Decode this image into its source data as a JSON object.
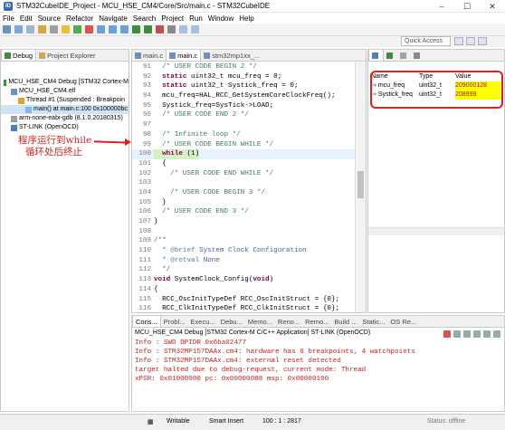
{
  "window": {
    "title": "STM32CubeIDE_Project - MCU_HSE_CM4/Core/Src/main.c - STM32CubeIDE"
  },
  "menu": [
    "File",
    "Edit",
    "Source",
    "Refactor",
    "Navigate",
    "Search",
    "Project",
    "Run",
    "Window",
    "Help"
  ],
  "quick_access": {
    "placeholder": "Quick Access"
  },
  "debug_panel": {
    "tabs": [
      "Debug",
      "Project Explorer"
    ],
    "tree": [
      {
        "label": "MCU_HSE_CM4 Debug [STM32 Cortex-M",
        "indent": 0
      },
      {
        "label": "MCU_HSE_CM4.elf",
        "indent": 1
      },
      {
        "label": "Thread #1 (Suspended : Breakpoin",
        "indent": 2
      },
      {
        "label": "main() at main.c:100 0x100000bc",
        "indent": 3,
        "selected": true
      },
      {
        "label": "arm-none-eabi-gdb (8.1.0.20180315)",
        "indent": 1
      },
      {
        "label": "ST-LINK (OpenOCD)",
        "indent": 1
      }
    ]
  },
  "annotation": {
    "line1": "程序运行到while",
    "line2": "循环处后终止"
  },
  "editor": {
    "tabs": [
      "main.c",
      "main.c",
      "stm32mp1xx_..."
    ],
    "lines": [
      {
        "n": "91",
        "t": "  /* USER CODE BEGIN 2 */"
      },
      {
        "n": "92",
        "t": "  static uint32_t mcu_freq = 0;"
      },
      {
        "n": "93",
        "t": "  static uint32_t Systick_freq = 0;"
      },
      {
        "n": "94",
        "t": "  mcu_freq=HAL_RCC_GetSystemCoreClockFreq();"
      },
      {
        "n": "95",
        "t": "  Systick_freq=SysTick->LOAD;"
      },
      {
        "n": "96",
        "t": "  /* USER CODE END 2 */"
      },
      {
        "n": "97",
        "t": ""
      },
      {
        "n": "98",
        "t": "  /* Infinite loop */"
      },
      {
        "n": "99",
        "t": "  /* USER CODE BEGIN WHILE */"
      },
      {
        "n": "100",
        "t": "  while (1)"
      },
      {
        "n": "101",
        "t": "  {"
      },
      {
        "n": "102",
        "t": "    /* USER CODE END WHILE */"
      },
      {
        "n": "103",
        "t": ""
      },
      {
        "n": "104",
        "t": "    /* USER CODE BEGIN 3 */"
      },
      {
        "n": "105",
        "t": "  }"
      },
      {
        "n": "106",
        "t": "  /* USER CODE END 3 */"
      },
      {
        "n": "107",
        "t": "}"
      },
      {
        "n": "108",
        "t": ""
      },
      {
        "n": "109",
        "t": "/**"
      },
      {
        "n": "110",
        "t": "  * @brief System Clock Configuration"
      },
      {
        "n": "111",
        "t": "  * @retval None"
      },
      {
        "n": "112",
        "t": "  */"
      },
      {
        "n": "113",
        "t": "void SystemClock_Config(void)"
      },
      {
        "n": "114",
        "t": "{"
      },
      {
        "n": "115",
        "t": "  RCC_OscInitTypeDef RCC_OscInitStruct = {0};"
      },
      {
        "n": "116",
        "t": "  RCC_ClkInitTypeDef RCC_ClkInitStruct = {0};"
      },
      {
        "n": "117",
        "t": ""
      },
      {
        "n": "118",
        "t": "  /** Initializes the RCC Oscillators according t"
      },
      {
        "n": "119",
        "t": "  * in the RCC_OscInitTypeDef structure."
      }
    ]
  },
  "variables": {
    "headers": [
      "Name",
      "Type",
      "Value"
    ],
    "rows": [
      {
        "name": "mcu_freq",
        "type": "uint32_t",
        "value": "209000128"
      },
      {
        "name": "Systick_freq",
        "type": "uint32_t",
        "value": "208999"
      }
    ]
  },
  "console": {
    "tabs": [
      "Cons...",
      "Probl...",
      "Execu...",
      "Debu...",
      "Memo...",
      "Reno...",
      "Remo...",
      "Build ...",
      "Static...",
      "OS Re..."
    ],
    "source": "MCU_HSE_CM4 Debug [STM32 Cortex-M C/C++ Application] ST-LINK (OpenOCD)",
    "lines": [
      "Info : SWD DPIDR 0x6ba02477",
      "Info : STM32MP157DAAx.cm4: hardware has 6 breakpoints, 4 watchpoints",
      "Info : STM32MP157DAAx.cm4: external reset detected",
      "target halted due to debug-request, current mode: Thread",
      "xPSR: 0x01000000 pc: 0x00000088 msp: 0x00000100"
    ]
  },
  "status": {
    "writable": "Writable",
    "insert": "Smart Insert",
    "position": "100 : 1 : 2817",
    "offline": "Status: offline"
  },
  "colors": {
    "accent": "#e02020",
    "highlight": "#ffff00"
  }
}
